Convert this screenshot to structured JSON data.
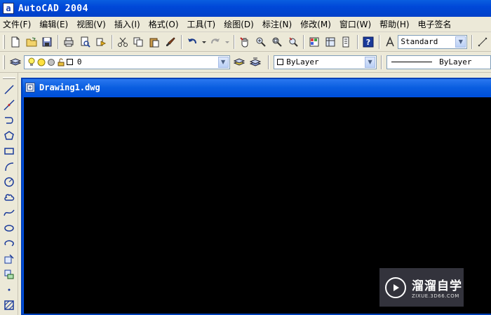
{
  "window": {
    "title": "AutoCAD 2004",
    "app_icon_glyph": "a"
  },
  "menu": [
    {
      "label": "文件(F)"
    },
    {
      "label": "编辑(E)"
    },
    {
      "label": "视图(V)"
    },
    {
      "label": "插入(I)"
    },
    {
      "label": "格式(O)"
    },
    {
      "label": "工具(T)"
    },
    {
      "label": "绘图(D)"
    },
    {
      "label": "标注(N)"
    },
    {
      "label": "修改(M)"
    },
    {
      "label": "窗口(W)"
    },
    {
      "label": "帮助(H)"
    },
    {
      "label": "电子签名"
    }
  ],
  "standard_toolbar": {
    "text_style": "Standard"
  },
  "layers_toolbar": {
    "current_layer": "0",
    "color": "ByLayer",
    "linetype": "ByLayer"
  },
  "document": {
    "title": "Drawing1.dwg"
  },
  "watermark": {
    "main": "溜溜自学",
    "sub": "ZIXUE.3D66.COM"
  },
  "colors": {
    "titlebar": "#0048d8",
    "canvas": "#000000",
    "face": "#ece9d8"
  }
}
